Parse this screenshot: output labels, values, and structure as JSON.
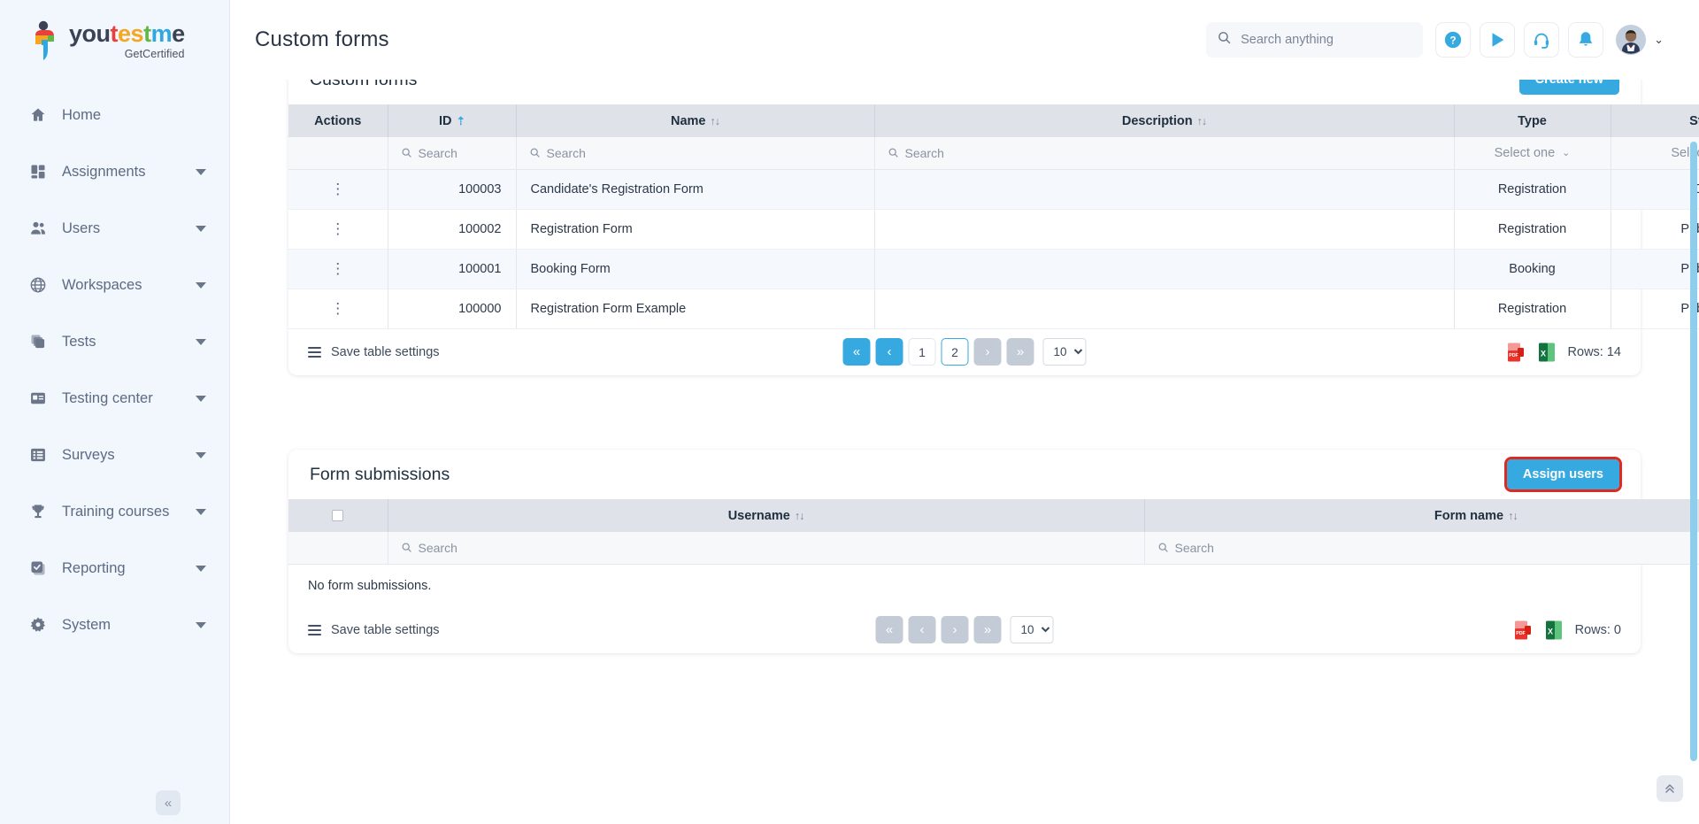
{
  "brand": {
    "word_parts": [
      "you",
      "t",
      "es",
      "t",
      "m",
      "e"
    ],
    "subtitle": "GetCertified"
  },
  "header": {
    "page_title": "Custom forms",
    "search_placeholder": "Search anything",
    "search_value": "",
    "icons": [
      "help-icon",
      "play-icon",
      "support-headset-icon",
      "notification-bell-icon"
    ]
  },
  "sidebar": {
    "items": [
      {
        "label": "Home",
        "icon": "home-icon",
        "has_caret": false
      },
      {
        "label": "Assignments",
        "icon": "assignments-icon",
        "has_caret": true
      },
      {
        "label": "Users",
        "icon": "users-icon",
        "has_caret": true
      },
      {
        "label": "Workspaces",
        "icon": "globe-icon",
        "has_caret": true
      },
      {
        "label": "Tests",
        "icon": "tests-stack-icon",
        "has_caret": true
      },
      {
        "label": "Testing center",
        "icon": "testing-center-icon",
        "has_caret": true
      },
      {
        "label": "Surveys",
        "icon": "surveys-list-icon",
        "has_caret": true
      },
      {
        "label": "Training courses",
        "icon": "trophy-icon",
        "has_caret": true
      },
      {
        "label": "Reporting",
        "icon": "reporting-check-icon",
        "has_caret": true
      },
      {
        "label": "System",
        "icon": "gear-icon",
        "has_caret": true
      }
    ],
    "collapse_label": "«"
  },
  "forms_card": {
    "title": "Custom forms",
    "create_label": "Create new",
    "columns": [
      {
        "label": "Actions",
        "sort": null
      },
      {
        "label": "ID",
        "sort": "asc"
      },
      {
        "label": "Name",
        "sort": "both"
      },
      {
        "label": "Description",
        "sort": "both"
      },
      {
        "label": "Type",
        "sort": null
      },
      {
        "label": "Status",
        "sort": null
      }
    ],
    "filters": {
      "actions": "",
      "id_placeholder": "Search",
      "name_placeholder": "Search",
      "description_placeholder": "Search",
      "type_select": "Select one",
      "status_select": "Select one"
    },
    "rows": [
      {
        "actions": "⋮",
        "id": "100003",
        "name": "Candidate's Registration Form",
        "description": "",
        "type": "Registration",
        "status": "Draft"
      },
      {
        "actions": "⋮",
        "id": "100002",
        "name": "Registration Form",
        "description": "",
        "type": "Registration",
        "status": "Published"
      },
      {
        "actions": "⋮",
        "id": "100001",
        "name": "Booking Form",
        "description": "",
        "type": "Booking",
        "status": "Published"
      },
      {
        "actions": "⋮",
        "id": "100000",
        "name": "Registration Form Example",
        "description": "",
        "type": "Registration",
        "status": "Published"
      }
    ],
    "footer": {
      "save_settings": "Save table settings",
      "first": "«",
      "prev": "‹",
      "next": "›",
      "last": "»",
      "pages": [
        "1",
        "2"
      ],
      "active_page": "2",
      "page_size": "10",
      "rows_label": "Rows: 14",
      "export_pdf": "pdf-export-icon",
      "export_excel": "excel-export-icon"
    }
  },
  "submissions_card": {
    "title": "Form submissions",
    "assign_label": "Assign users",
    "columns": [
      {
        "label": "",
        "sort": null
      },
      {
        "label": "Username",
        "sort": "both"
      },
      {
        "label": "Form name",
        "sort": "both"
      }
    ],
    "filters": {
      "username_placeholder": "Search",
      "form_name_placeholder": "Search"
    },
    "empty_message": "No form submissions.",
    "footer": {
      "save_settings": "Save table settings",
      "first": "«",
      "prev": "‹",
      "next": "›",
      "last": "»",
      "page_size": "10",
      "rows_label": "Rows: 0",
      "export_pdf": "pdf-export-icon",
      "export_excel": "excel-export-icon"
    }
  },
  "scroll_top_label": "⌃"
}
